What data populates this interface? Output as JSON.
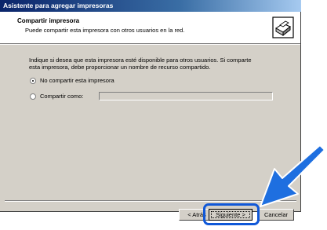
{
  "window": {
    "title": "Asistente para agregar impresoras"
  },
  "header": {
    "title": "Compartir impresora",
    "description": "Puede compartir esta impresora con otros usuarios en la red.",
    "icon": "printer-icon"
  },
  "body": {
    "instructions_line1": "Indique si desea que esta impresora esté disponible para otros usuarios. Si comparte",
    "instructions_line2": "esta impresora, debe proporcionar un nombre de recurso compartido.",
    "options": [
      {
        "label": "No compartir esta impresora",
        "selected": true
      },
      {
        "label": "Compartir como:",
        "selected": false
      }
    ],
    "share_name_value": ""
  },
  "buttons": {
    "back_label": "< Atrás",
    "next_label": "Siguiente >",
    "cancel_label": "Cancelar"
  },
  "annotation": {
    "highlight_color": "#1058d8",
    "arrow_color": "#1e6fe0"
  }
}
